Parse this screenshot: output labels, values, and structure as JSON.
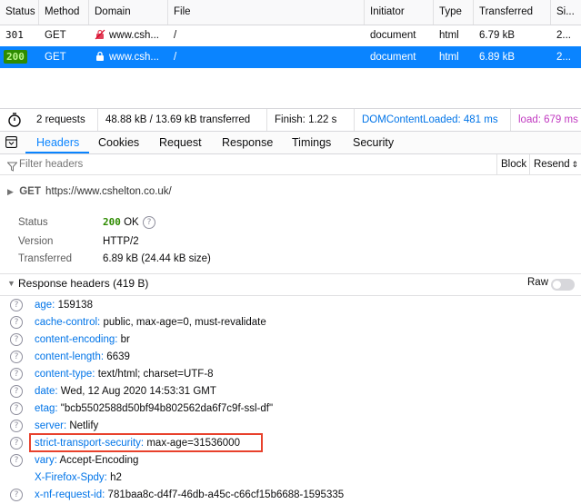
{
  "table": {
    "columns": [
      "Status",
      "Method",
      "Domain",
      "File",
      "Initiator",
      "Type",
      "Transferred",
      "Si..."
    ],
    "rows": [
      {
        "status": "301",
        "method": "GET",
        "domain": "www.csh...",
        "file": "/",
        "initiator": "document",
        "type": "html",
        "transferred": "6.79 kB",
        "size": "2..."
      },
      {
        "status": "200",
        "method": "GET",
        "domain": "www.csh...",
        "file": "/",
        "initiator": "document",
        "type": "html",
        "transferred": "6.89 kB",
        "size": "2..."
      }
    ]
  },
  "summary": {
    "requests": "2 requests",
    "transferred": "48.88 kB / 13.69 kB transferred",
    "finish": "Finish: 1.22 s",
    "domcontentloaded": "DOMContentLoaded: 481 ms",
    "load": "load: 679 ms"
  },
  "tabs": [
    "Headers",
    "Cookies",
    "Request",
    "Response",
    "Timings",
    "Security"
  ],
  "filter": {
    "placeholder": "Filter headers",
    "block": "Block",
    "resend": "Resend"
  },
  "request_line": {
    "method": "GET",
    "url": "https://www.cshelton.co.uk/"
  },
  "info": {
    "status_label": "Status",
    "status_code": "200",
    "status_text": "OK",
    "version_label": "Version",
    "version_value": "HTTP/2",
    "transferred_label": "Transferred",
    "transferred_value": "6.89 kB (24.44 kB size)"
  },
  "response_headers": {
    "title": "Response headers (419 B)",
    "raw_label": "Raw",
    "items": [
      {
        "key": "age:",
        "value": "159138"
      },
      {
        "key": "cache-control:",
        "value": "public, max-age=0, must-revalidate"
      },
      {
        "key": "content-encoding:",
        "value": "br"
      },
      {
        "key": "content-length:",
        "value": "6639"
      },
      {
        "key": "content-type:",
        "value": "text/html; charset=UTF-8"
      },
      {
        "key": "date:",
        "value": "Wed, 12 Aug 2020 14:53:31 GMT"
      },
      {
        "key": "etag:",
        "value": "\"bcb5502588d50bf94b802562da6f7c9f-ssl-df\""
      },
      {
        "key": "server:",
        "value": "Netlify"
      },
      {
        "key": "strict-transport-security:",
        "value": "max-age=31536000"
      },
      {
        "key": "vary:",
        "value": "Accept-Encoding"
      },
      {
        "key": "X-Firefox-Spdy:",
        "value": "h2"
      },
      {
        "key": "x-nf-request-id:",
        "value": "781baa8c-d4f7-46db-a45c-c66cf15b6688-1595335"
      }
    ]
  },
  "colors": {
    "accent": "#0a84ff",
    "highlight_box": "#e8412c",
    "status_ok": "#2e8b00"
  }
}
